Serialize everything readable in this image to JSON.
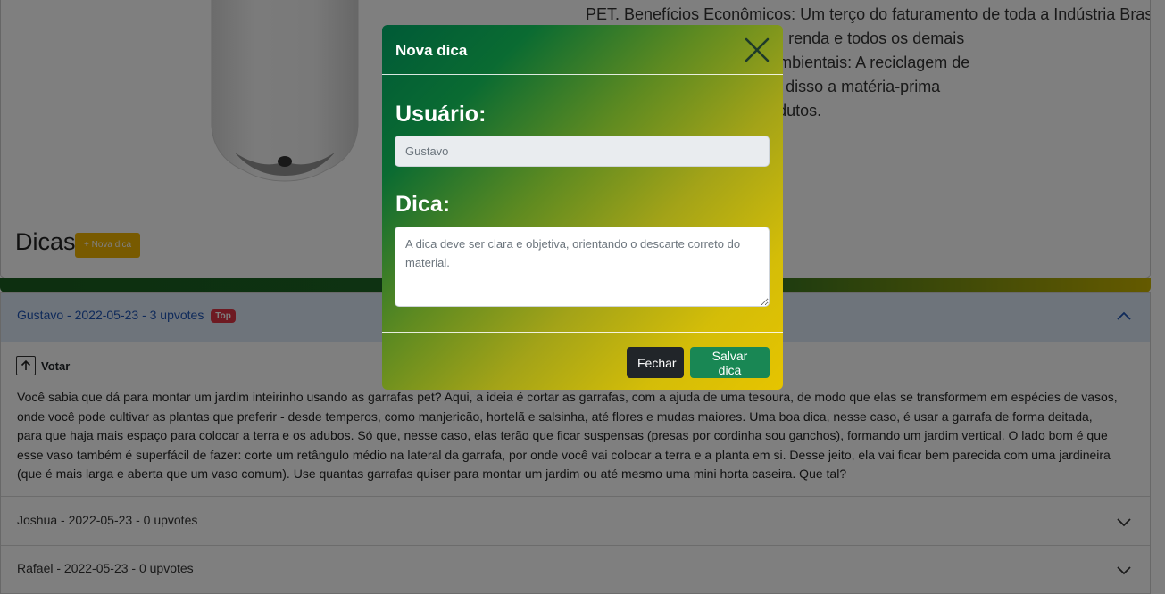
{
  "article": {
    "lines": [
      "PET. Benefícios Econômicos: Um terço do faturamento de toda a Indústria Brasileira",
      ". Gera impostos, empregos, renda e todos os demais",
      "e base sólida. Benefícios Ambientais: A reciclagem de",
      "urais, água e energia. Além disso a matéria-prima",
      "rgem em muitos outros produtos."
    ]
  },
  "dicas": {
    "title": "Dicas",
    "new_button": "+ Nova dica",
    "vote_label": "Votar",
    "items": [
      {
        "header": "Gustavo - 2022-05-23 - 3 upvotes",
        "badge": "Top"
      },
      {
        "header": "Joshua - 2022-05-23 - 0 upvotes"
      },
      {
        "header": "Rafael - 2022-05-23 - 0 upvotes"
      }
    ],
    "open_text_lines": [
      "Você sabia que dá para montar um jardim inteirinho usando as garrafas pet? Aqui, a ideia é cortar as garrafas, com a ajuda de uma tesoura, de modo que elas se transformem em espécies de vasos,",
      "onde você pode cultivar as plantas que preferir - desde temperos, como manjericão, hortelã e salsinha, até flores e mudas maiores. Uma boa dica, nesse caso, é usar a garrafa de forma deitada,",
      "para que haja mais espaço para colocar a terra e os adubos. Só que, nesse caso, elas terão que ficar suspensas (presas por cordinha sou ganchos), formando um jardim vertical. O lado bom é que",
      "esse vaso também é superfácil de fazer: corte um retângulo médio na lateral da garrafa, por onde você vai colocar a terra e a planta em si. Desse jeito, ela vai ficar bem parecida com uma jardineira",
      "(que é mais larga e aberta que um vaso comum). Use quantas garrafas quiser para montar um jardim ou até mesmo uma mini horta caseira. Que tal?"
    ]
  },
  "modal": {
    "title": "Nova dica",
    "user_label": "Usuário:",
    "user_value": "Gustavo",
    "tip_label": "Dica:",
    "tip_placeholder": "A dica deve ser clara e objetiva, orientando o descarte correto do material.",
    "close_button": "Fechar",
    "save_button": "Salvar dica"
  },
  "colors": {
    "save": "#198754",
    "close": "#212529",
    "badge": "#dc3545",
    "new_tip_button": "#f0b400"
  },
  "icons": [
    "close-icon",
    "arrow-up-icon",
    "chevron-up-icon",
    "chevron-down-icon"
  ]
}
